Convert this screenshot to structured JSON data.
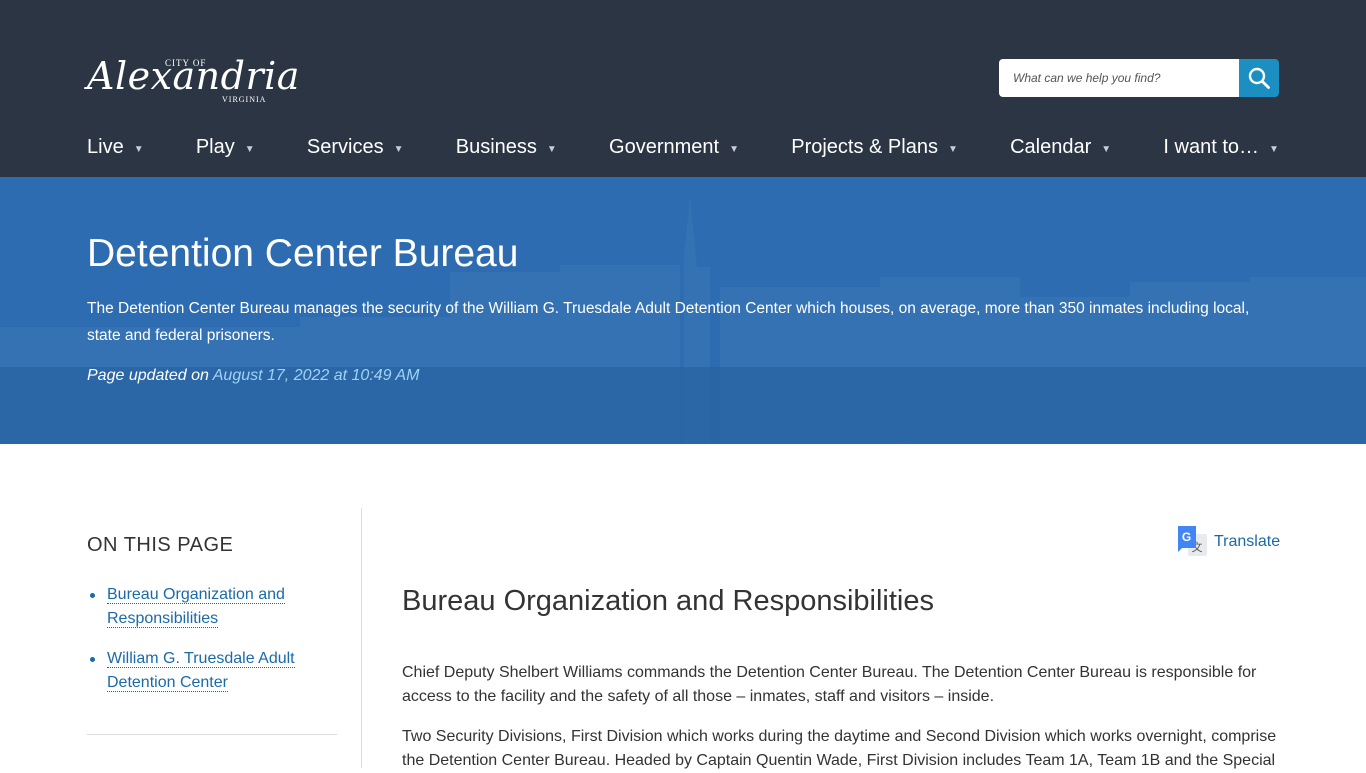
{
  "header": {
    "logo": {
      "city_of": "CITY OF",
      "name": "Alexandria",
      "state": "VIRGINIA"
    },
    "search": {
      "placeholder": "What can we help you find?"
    },
    "nav": [
      {
        "label": "Live"
      },
      {
        "label": "Play"
      },
      {
        "label": "Services"
      },
      {
        "label": "Business"
      },
      {
        "label": "Government"
      },
      {
        "label": "Projects & Plans"
      },
      {
        "label": "Calendar"
      },
      {
        "label": "I want to…"
      }
    ]
  },
  "hero": {
    "title": "Detention Center Bureau",
    "description": "The Detention Center Bureau manages the security of the William G. Truesdale Adult Detention Center which houses, on average, more than 350 inmates including local, state and federal prisoners.",
    "updated_label": "Page updated on",
    "updated_date": "August 17, 2022 at 10:49 AM"
  },
  "sidebar": {
    "heading": "ON THIS PAGE",
    "links": [
      {
        "label": "Bureau Organization and Responsibilities"
      },
      {
        "label": "William G. Truesdale Adult Detention Center"
      }
    ]
  },
  "main": {
    "translate_label": "Translate",
    "section_title": "Bureau Organization and Responsibilities",
    "paragraph_1": "Chief Deputy Shelbert Williams commands the Detention Center Bureau. The Detention Center Bureau is responsible for access to the facility and the safety of all those – inmates, staff and visitors – inside.",
    "paragraph_2": "Two Security Divisions, First Division which works during the daytime and Second Division which works overnight, comprise the Detention Center Bureau. Headed by Captain Quentin Wade, First Division includes Team 1A, Team 1B and the Special"
  },
  "colors": {
    "header_bg": "#2b3544",
    "search_button": "#1c8fc2",
    "hero_blue": "#2f6fb2",
    "link": "#1a6aa8"
  },
  "icons": {
    "search": "search-icon",
    "translate": "google-translate-icon",
    "nav_caret": "caret-down-icon"
  }
}
